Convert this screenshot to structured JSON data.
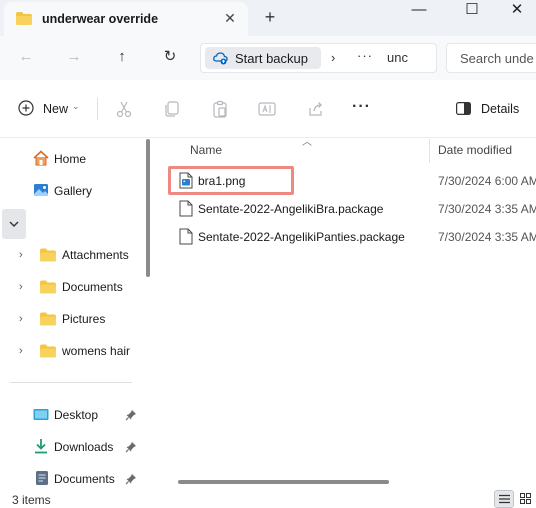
{
  "window": {
    "tab_title": "underwear override",
    "tab_close_icon": "close-icon",
    "new_tab_label": "+",
    "controls": {
      "minimize": "—",
      "maximize": "☐",
      "close": "✕"
    }
  },
  "addressbar": {
    "back_icon": "arrow-left-icon",
    "forward_icon": "arrow-right-icon",
    "up_icon": "arrow-up-icon",
    "refresh_icon": "refresh-icon",
    "backup_label": "Start backup",
    "separator": "›",
    "more": "···",
    "current": "unc",
    "search_placeholder": "Search unde"
  },
  "commandbar": {
    "new_label": "New",
    "new_caret": "⌄",
    "icons": [
      "cut-icon",
      "copy-icon",
      "paste-icon",
      "rename-icon",
      "share-icon"
    ],
    "more_label": "···",
    "details_label": "Details"
  },
  "sidebar": {
    "top_items": [
      {
        "label": "Home",
        "icon": "home-icon"
      },
      {
        "label": "Gallery",
        "icon": "gallery-icon"
      }
    ],
    "collapse_icon": "chevron-down-icon",
    "folders": [
      {
        "label": "Attachments",
        "icon": "folder-icon"
      },
      {
        "label": "Documents",
        "icon": "folder-icon"
      },
      {
        "label": "Pictures",
        "icon": "folder-icon"
      },
      {
        "label": "womens hair",
        "icon": "folder-icon"
      }
    ],
    "pinned": [
      {
        "label": "Desktop",
        "icon": "desktop-icon"
      },
      {
        "label": "Downloads",
        "icon": "download-icon"
      },
      {
        "label": "Documents",
        "icon": "document-icon"
      }
    ]
  },
  "files": {
    "columns": {
      "name": "Name",
      "date": "Date modified"
    },
    "rows": [
      {
        "name": "bra1.png",
        "date": "7/30/2024 6:00 AM",
        "icon": "image-file-icon",
        "highlighted": true
      },
      {
        "name": "Sentate-2022-AngelikiBra.package",
        "date": "7/30/2024 3:35 AM",
        "icon": "file-icon",
        "highlighted": false
      },
      {
        "name": "Sentate-2022-AngelikiPanties.package",
        "date": "7/30/2024 3:35 AM",
        "icon": "file-icon",
        "highlighted": false
      }
    ]
  },
  "status": {
    "count": "3 items"
  },
  "colors": {
    "accent": "#0067c0",
    "folder": "#f4c542",
    "highlight": "#ec8a82",
    "chrome": "#eef2f7"
  }
}
